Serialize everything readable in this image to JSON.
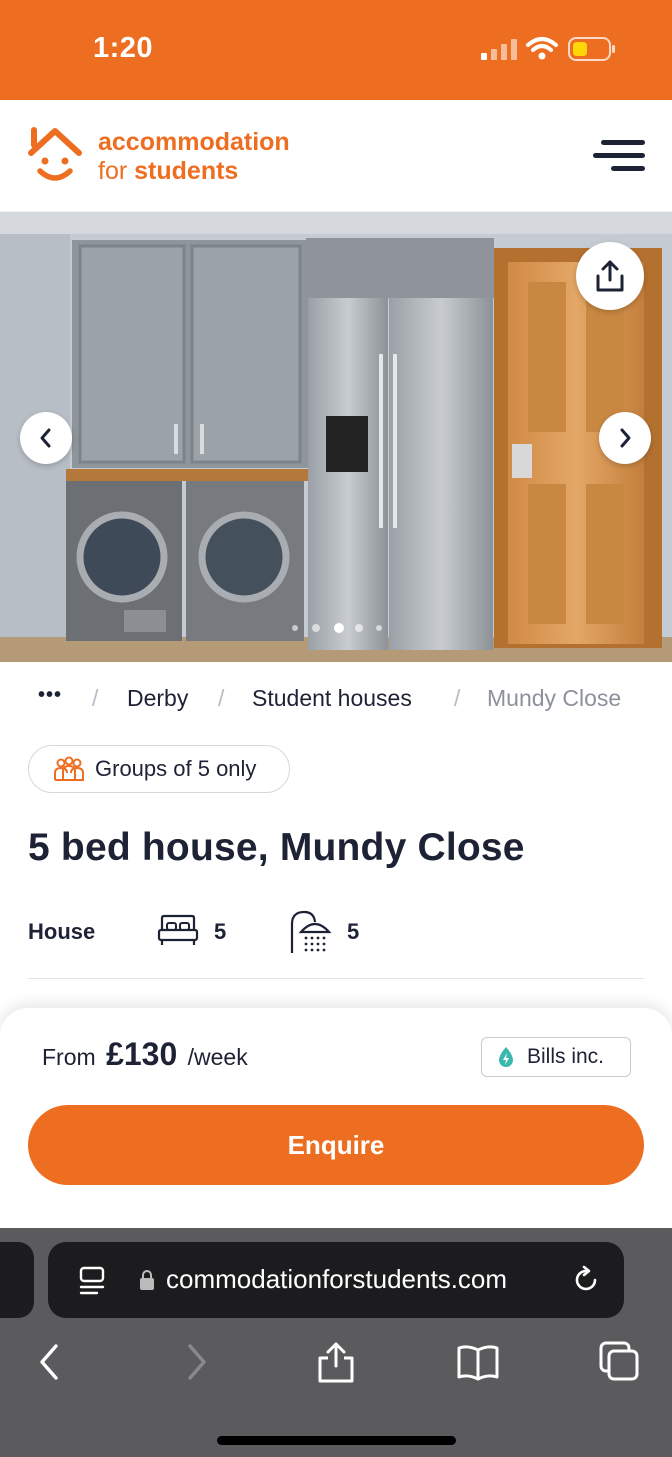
{
  "status_bar": {
    "time": "1:20"
  },
  "header": {
    "logo_line1": "accommodation",
    "logo_for": "for",
    "logo_students": "students"
  },
  "gallery": {
    "active_index": 2,
    "total": 5
  },
  "breadcrumb": {
    "ellipsis": "•••",
    "items": [
      "Derby",
      "Student houses",
      "Mundy Close"
    ],
    "separator": "/"
  },
  "listing": {
    "groups_label": "Groups of 5 only",
    "title": "5 bed house, Mundy Close",
    "property_type": "House",
    "bedrooms": "5",
    "bathrooms": "5"
  },
  "pricing": {
    "from_label": "From",
    "price": "£130",
    "period": "/week",
    "bills_label": "Bills inc."
  },
  "cta": {
    "enquire_label": "Enquire"
  },
  "browser": {
    "url": "commodationforstudents.com"
  },
  "colors": {
    "brand": "#ee6e21",
    "text": "#1e2235",
    "bills_accent": "#3ab8b0"
  }
}
